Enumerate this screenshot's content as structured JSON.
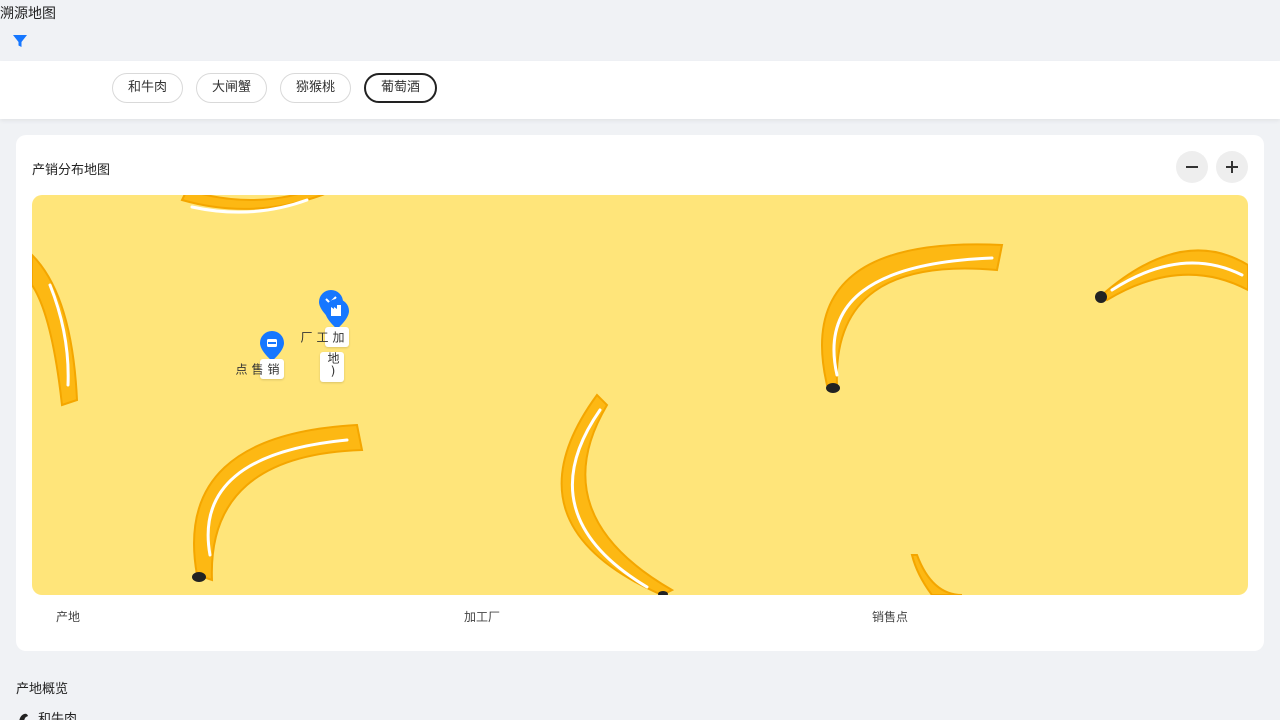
{
  "page": {
    "title": "溯源地图"
  },
  "filter": {
    "icon": "filter-icon",
    "color": "#1677ff"
  },
  "tabs": [
    {
      "label": "和牛肉",
      "active": false
    },
    {
      "label": "大闸蟹",
      "active": false
    },
    {
      "label": "猕猴桃",
      "active": false
    },
    {
      "label": "葡萄酒",
      "active": true
    }
  ],
  "map_card": {
    "title": "产销分布地图",
    "zoom_out_icon": "minus-icon",
    "zoom_in_icon": "plus-icon",
    "background_color": "#ffe57a",
    "marker_color": "#1677ff",
    "markers": [
      {
        "kind": "sales",
        "icon": "store-icon",
        "label": "销售点"
      },
      {
        "kind": "factory",
        "icon": "factory-icon",
        "label": "加工厂"
      },
      {
        "kind": "origin",
        "icon": "farm-icon",
        "label": "地)"
      }
    ],
    "legend": [
      "产地",
      "加工厂",
      "销售点"
    ]
  },
  "overview": {
    "title": "产地概览",
    "first_item": {
      "label": "和牛肉",
      "icon": "cow-icon"
    }
  }
}
